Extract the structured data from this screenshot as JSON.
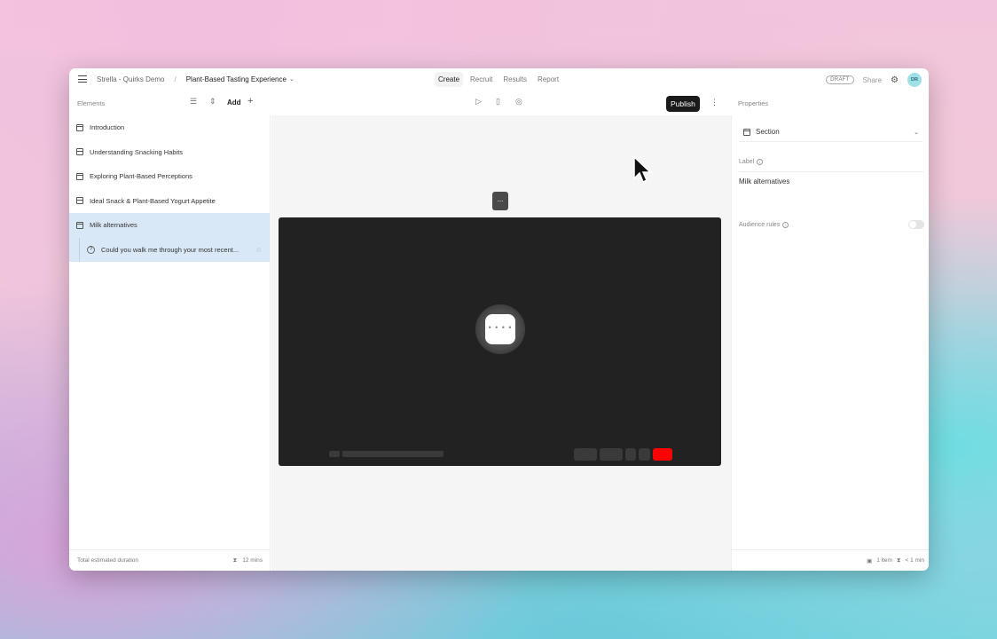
{
  "topbar": {
    "org": "Strella - Quirks Demo",
    "separator": "/",
    "study": "Plant-Based Tasting Experience",
    "tabs": [
      "Create",
      "Recruit",
      "Results",
      "Report"
    ],
    "active_tab": "Create",
    "status_badge": "DRAFT",
    "share_label": "Share",
    "avatar_initials": "DR"
  },
  "toolbar": {
    "elements_title": "Elements",
    "add_label": "Add",
    "publish_label": "Publish",
    "properties_title": "Properties"
  },
  "elements": {
    "items": [
      {
        "label": "Introduction"
      },
      {
        "label": "Understanding Snacking Habits"
      },
      {
        "label": "Exploring Plant-Based Perceptions"
      },
      {
        "label": "Ideal Snack & Plant-Based Yogurt Appetite"
      },
      {
        "label": "Milk alternatives"
      }
    ],
    "selected_index": 4,
    "sub_item": "Could you walk me through your most recent..."
  },
  "footer_left": {
    "label": "Total estimated duration",
    "duration": "12 mins"
  },
  "canvas": {
    "dots_label": "...",
    "loader_label": "• • • •"
  },
  "properties": {
    "type": "Section",
    "label_title": "Label",
    "label_value": "Milk alternatives",
    "audience_title": "Audience rules",
    "audience_enabled": false
  },
  "footer_right": {
    "items": "1 item",
    "duration": "< 1 min"
  },
  "colors": {
    "selected_bg": "#d9e8f7",
    "publish_bg": "#1a1a1a",
    "end_call": "#ff0000",
    "avatar_bg": "#9ee0e6"
  }
}
